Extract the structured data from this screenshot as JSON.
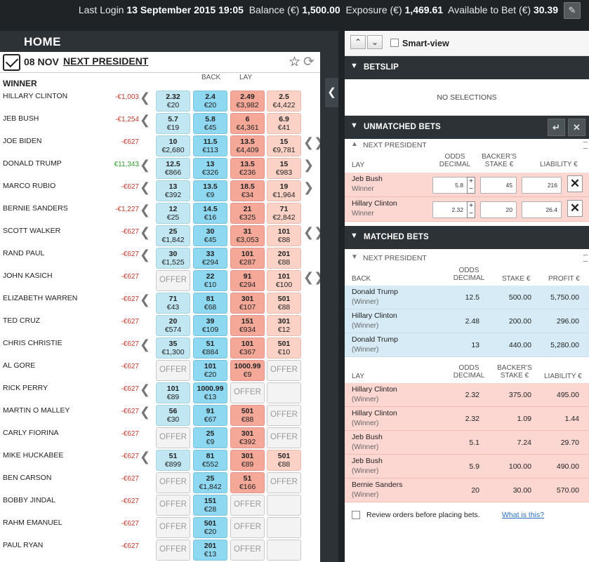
{
  "topbar": {
    "last_login_label": "Last Login",
    "last_login_value": "13 September 2015 19:05",
    "balance_label": "Balance (€)",
    "balance_value": "1,500.00",
    "exposure_label": "Exposure (€)",
    "exposure_value": "1,469.61",
    "available_label": "Available to Bet (€)",
    "available_value": "30.39"
  },
  "left": {
    "home_label": "HOME",
    "event_date": "08 NOV",
    "event_name": "NEXT PRESIDENT",
    "market_label": "WINNER",
    "back_label": "BACK",
    "lay_label": "LAY",
    "offer_label": "OFFER"
  },
  "runners": [
    {
      "name": "HILLARY CLINTON",
      "pl": "-€1,003",
      "arrowL": "❮",
      "arrowR": "",
      "b1": {
        "o": "2.32",
        "s": "€20"
      },
      "b2": {
        "o": "2.4",
        "s": "€20"
      },
      "l1": {
        "o": "2.49",
        "s": "€3,982"
      },
      "l2": {
        "o": "2.5",
        "s": "€4,422"
      }
    },
    {
      "name": "JEB BUSH",
      "pl": "-€1,254",
      "arrowL": "❮",
      "arrowR": "",
      "b1": {
        "o": "5.7",
        "s": "€19"
      },
      "b2": {
        "o": "5.8",
        "s": "€45"
      },
      "l1": {
        "o": "6",
        "s": "€4,361"
      },
      "l2": {
        "o": "6.9",
        "s": "€41"
      }
    },
    {
      "name": "JOE BIDEN",
      "pl": "-€627",
      "arrowL": "",
      "arrowR": "❮❯",
      "b1": {
        "o": "10",
        "s": "€2,680"
      },
      "b2": {
        "o": "11.5",
        "s": "€113"
      },
      "l1": {
        "o": "13.5",
        "s": "€4,409"
      },
      "l2": {
        "o": "15",
        "s": "€9,781"
      }
    },
    {
      "name": "DONALD TRUMP",
      "pl": "€11,343",
      "pos": true,
      "arrowL": "❮",
      "arrowR": "❯",
      "b1": {
        "o": "12.5",
        "s": "€866"
      },
      "b2": {
        "o": "13",
        "s": "€326"
      },
      "l1": {
        "o": "13.5",
        "s": "€236"
      },
      "l2": {
        "o": "15",
        "s": "€983"
      }
    },
    {
      "name": "MARCO RUBIO",
      "pl": "-€627",
      "arrowL": "❮",
      "arrowR": "❯",
      "b1": {
        "o": "13",
        "s": "€392"
      },
      "b2": {
        "o": "13.5",
        "s": "€9"
      },
      "l1": {
        "o": "18.5",
        "s": "€34"
      },
      "l2": {
        "o": "19",
        "s": "€1,964"
      }
    },
    {
      "name": "BERNIE SANDERS",
      "pl": "-€1,227",
      "arrowL": "❮",
      "arrowR": "",
      "b1": {
        "o": "12",
        "s": "€25"
      },
      "b2": {
        "o": "14.5",
        "s": "€16"
      },
      "l1": {
        "o": "21",
        "s": "€325"
      },
      "l2": {
        "o": "71",
        "s": "€2,842"
      }
    },
    {
      "name": "SCOTT WALKER",
      "pl": "-€627",
      "arrowL": "❮",
      "arrowR": "❮❯",
      "b1": {
        "o": "25",
        "s": "€1,842"
      },
      "b2": {
        "o": "30",
        "s": "€45"
      },
      "l1": {
        "o": "31",
        "s": "€3,053"
      },
      "l2": {
        "o": "101",
        "s": "€88"
      }
    },
    {
      "name": "RAND PAUL",
      "pl": "-€627",
      "arrowL": "❮",
      "arrowR": "",
      "b1": {
        "o": "30",
        "s": "€1,525"
      },
      "b2": {
        "o": "33",
        "s": "€294"
      },
      "l1": {
        "o": "101",
        "s": "€287"
      },
      "l2": {
        "o": "201",
        "s": "€88"
      }
    },
    {
      "name": "JOHN KASICH",
      "pl": "-€627",
      "arrowL": "",
      "arrowR": "❮❯",
      "b1": "offer",
      "b2": {
        "o": "22",
        "s": "€10"
      },
      "l1": {
        "o": "91",
        "s": "€294"
      },
      "l2": {
        "o": "101",
        "s": "€100"
      }
    },
    {
      "name": "ELIZABETH WARREN",
      "pl": "-€627",
      "arrowL": "❮",
      "arrowR": "",
      "b1": {
        "o": "71",
        "s": "€43"
      },
      "b2": {
        "o": "81",
        "s": "€68"
      },
      "l1": {
        "o": "301",
        "s": "€107"
      },
      "l2": {
        "o": "501",
        "s": "€88"
      }
    },
    {
      "name": "TED CRUZ",
      "pl": "-€627",
      "arrowL": "",
      "arrowR": "",
      "b1": {
        "o": "20",
        "s": "€574"
      },
      "b2": {
        "o": "39",
        "s": "€109"
      },
      "l1": {
        "o": "151",
        "s": "€934"
      },
      "l2": {
        "o": "301",
        "s": "€12"
      }
    },
    {
      "name": "CHRIS CHRISTIE",
      "pl": "-€627",
      "arrowL": "❮",
      "arrowR": "",
      "b1": {
        "o": "35",
        "s": "€1,300"
      },
      "b2": {
        "o": "51",
        "s": "€884"
      },
      "l1": {
        "o": "101",
        "s": "€367"
      },
      "l2": {
        "o": "501",
        "s": "€10"
      }
    },
    {
      "name": "AL GORE",
      "pl": "-€627",
      "arrowL": "",
      "arrowR": "",
      "b1": "offer",
      "b2": {
        "o": "101",
        "s": "€20"
      },
      "l1": {
        "o": "1000.99",
        "s": "€9"
      },
      "l2": "offer"
    },
    {
      "name": "RICK PERRY",
      "pl": "-€627",
      "arrowL": "❮",
      "arrowR": "",
      "b1": {
        "o": "101",
        "s": "€89"
      },
      "b2": {
        "o": "1000.99",
        "s": "€13"
      },
      "l1": "offer",
      "l2": "empty"
    },
    {
      "name": "MARTIN O MALLEY",
      "pl": "-€627",
      "arrowL": "❮",
      "arrowR": "",
      "b1": {
        "o": "56",
        "s": "€30"
      },
      "b2": {
        "o": "91",
        "s": "€67"
      },
      "l1": {
        "o": "501",
        "s": "€88"
      },
      "l2": "offer"
    },
    {
      "name": "CARLY FIORINA",
      "pl": "-€627",
      "arrowL": "",
      "arrowR": "",
      "b1": "offer",
      "b2": {
        "o": "25",
        "s": "€9"
      },
      "l1": {
        "o": "301",
        "s": "€392"
      },
      "l2": "offer"
    },
    {
      "name": "MIKE HUCKABEE",
      "pl": "-€627",
      "arrowL": "❮",
      "arrowR": "",
      "b1": {
        "o": "51",
        "s": "€899"
      },
      "b2": {
        "o": "81",
        "s": "€552"
      },
      "l1": {
        "o": "301",
        "s": "€89"
      },
      "l2": {
        "o": "501",
        "s": "€88"
      }
    },
    {
      "name": "BEN CARSON",
      "pl": "-€627",
      "arrowL": "",
      "arrowR": "",
      "b1": "offer",
      "b2": {
        "o": "25",
        "s": "€1,842"
      },
      "l1": {
        "o": "51",
        "s": "€166"
      },
      "l2": "offer"
    },
    {
      "name": "BOBBY JINDAL",
      "pl": "-€627",
      "arrowL": "",
      "arrowR": "",
      "b1": "offer",
      "b2": {
        "o": "151",
        "s": "€28"
      },
      "l1": "offer",
      "l2": "empty"
    },
    {
      "name": "RAHM EMANUEL",
      "pl": "-€627",
      "arrowL": "",
      "arrowR": "",
      "b1": "offer",
      "b2": {
        "o": "501",
        "s": "€20"
      },
      "l1": "offer",
      "l2": "empty"
    },
    {
      "name": "PAUL RYAN",
      "pl": "-€627",
      "arrowL": "",
      "arrowR": "",
      "b1": "offer",
      "b2": {
        "o": "201",
        "s": "€13"
      },
      "l1": "offer",
      "l2": "empty"
    }
  ],
  "right": {
    "smart_view_label": "Smart-view",
    "betslip_title": "BETSLIP",
    "no_selections": "NO SELECTIONS",
    "unmatched_title": "UNMATCHED BETS",
    "matched_title": "MATCHED BETS",
    "market_name": "NEXT PRESIDENT",
    "unmatched_cols": {
      "side": "LAY",
      "odds1": "ODDS",
      "odds2": "DECIMAL",
      "stake1": "BACKER'S",
      "stake2": "STAKE €",
      "liab": "LIABILITY €"
    },
    "unmatched": [
      {
        "name": "Jeb Bush",
        "sub": "Winner",
        "odds": "5.8",
        "stake": "45",
        "liability": "216"
      },
      {
        "name": "Hillary Clinton",
        "sub": "Winner",
        "odds": "2.32",
        "stake": "20",
        "liability": "26.4"
      }
    ],
    "matched_back_cols": {
      "side": "BACK",
      "odds1": "ODDS",
      "odds2": "DECIMAL",
      "stake": "STAKE €",
      "profit": "PROFIT €"
    },
    "matched_back": [
      {
        "name": "Donald Trump",
        "sub": "(Winner)",
        "odds": "12.5",
        "stake": "500.00",
        "profit": "5,750.00"
      },
      {
        "name": "Hillary Clinton",
        "sub": "(Winner)",
        "odds": "2.48",
        "stake": "200.00",
        "profit": "296.00"
      },
      {
        "name": "Donald Trump",
        "sub": "(Winner)",
        "odds": "13",
        "stake": "440.00",
        "profit": "5,280.00"
      }
    ],
    "matched_lay_cols": {
      "side": "LAY",
      "odds1": "ODDS",
      "odds2": "DECIMAL",
      "stake1": "BACKER'S",
      "stake2": "STAKE €",
      "liab": "LIABILITY €"
    },
    "matched_lay": [
      {
        "name": "Hillary Clinton",
        "sub": "(Winner)",
        "odds": "2.32",
        "stake": "375.00",
        "liability": "495.00"
      },
      {
        "name": "Hillary Clinton",
        "sub": "(Winner)",
        "odds": "2.32",
        "stake": "1.09",
        "liability": "1.44"
      },
      {
        "name": "Jeb Bush",
        "sub": "(Winner)",
        "odds": "5.1",
        "stake": "7.24",
        "liability": "29.70"
      },
      {
        "name": "Jeb Bush",
        "sub": "(Winner)",
        "odds": "5.9",
        "stake": "100.00",
        "liability": "490.00"
      },
      {
        "name": "Bernie Sanders",
        "sub": "(Winner)",
        "odds": "20",
        "stake": "30.00",
        "liability": "570.00"
      }
    ],
    "review_label": "Review orders before placing bets.",
    "what_is_this": "What is this?"
  }
}
